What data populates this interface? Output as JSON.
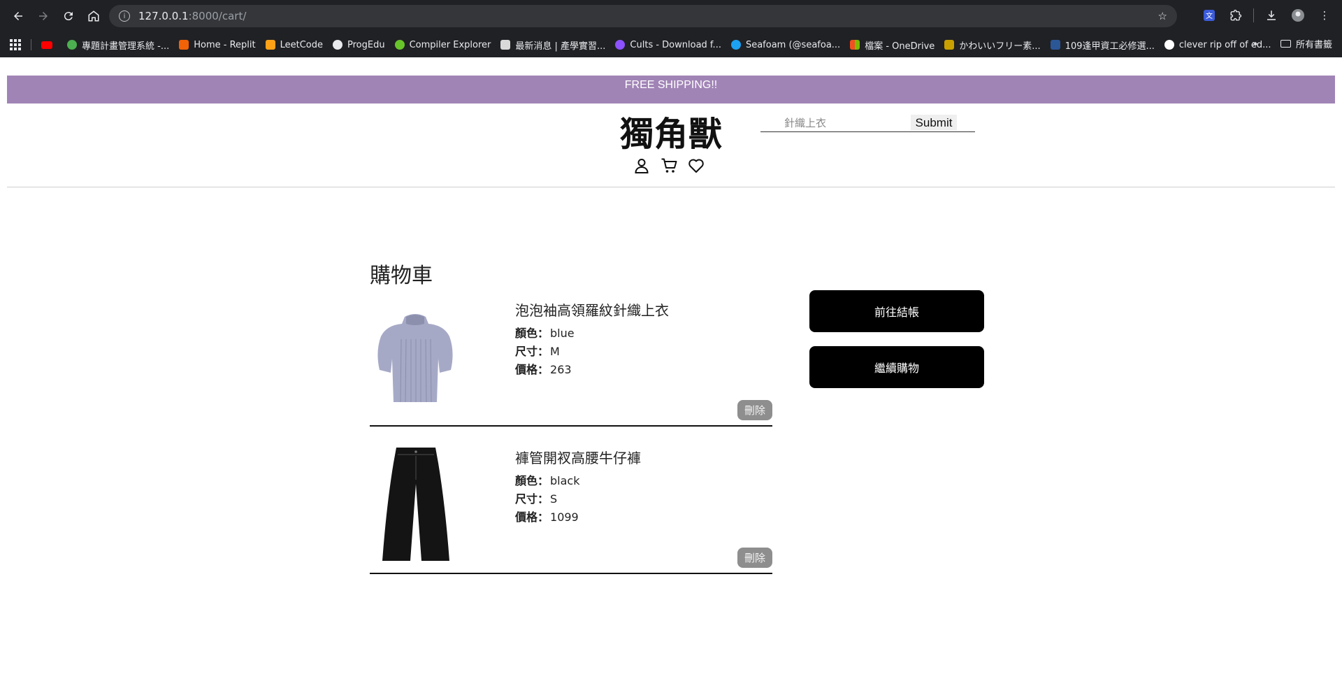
{
  "browser": {
    "url_host": "127.0.0.1",
    "url_rest": ":8000/cart/",
    "bookmarks": [
      {
        "label": "",
        "color": "#ff0000"
      },
      {
        "label": "專題計畫管理系統 -...",
        "color": "#4caf50"
      },
      {
        "label": "Home - Replit",
        "color": "#f26207"
      },
      {
        "label": "LeetCode",
        "color": "#ffa116"
      },
      {
        "label": "ProgEdu",
        "color": "#e8eaed"
      },
      {
        "label": "Compiler Explorer",
        "color": "#67c52a"
      },
      {
        "label": "最新消息 | 產學實習...",
        "color": "#d9d9d9"
      },
      {
        "label": "Cults - Download f...",
        "color": "#8c52ff"
      },
      {
        "label": "Seafoam (@seafoa...",
        "color": "#1da1f2"
      },
      {
        "label": "檔案 - OneDrive",
        "color": "#f25022"
      },
      {
        "label": "かわいいフリー素...",
        "color": "#c8a000"
      },
      {
        "label": "109逢甲資工必修選...",
        "color": "#2b5797"
      },
      {
        "label": "clever rip off of ed...",
        "color": "#ffffff"
      }
    ],
    "more_label": "»",
    "folder_label": "所有書籤"
  },
  "site": {
    "banner": "FREE SHIPPING!!",
    "logo": "獨角獸",
    "search_placeholder": "針織上衣",
    "search_submit": "Submit"
  },
  "cart": {
    "title": "購物車",
    "labels": {
      "color": "顏色：",
      "size": "尺寸：",
      "price": "價格："
    },
    "items": [
      {
        "name": "泡泡袖高領羅紋針織上衣",
        "color": "blue",
        "size": "M",
        "price": "263",
        "delete": "刪除"
      },
      {
        "name": "褲管開衩高腰牛仔褲",
        "color": "black",
        "size": "S",
        "price": "1099",
        "delete": "刪除"
      }
    ],
    "checkout_label": "前往結帳",
    "continue_label": "繼續購物"
  },
  "colors": {
    "banner": "#a184b6",
    "button": "#000000",
    "delete_button": "#8e8e8e"
  }
}
